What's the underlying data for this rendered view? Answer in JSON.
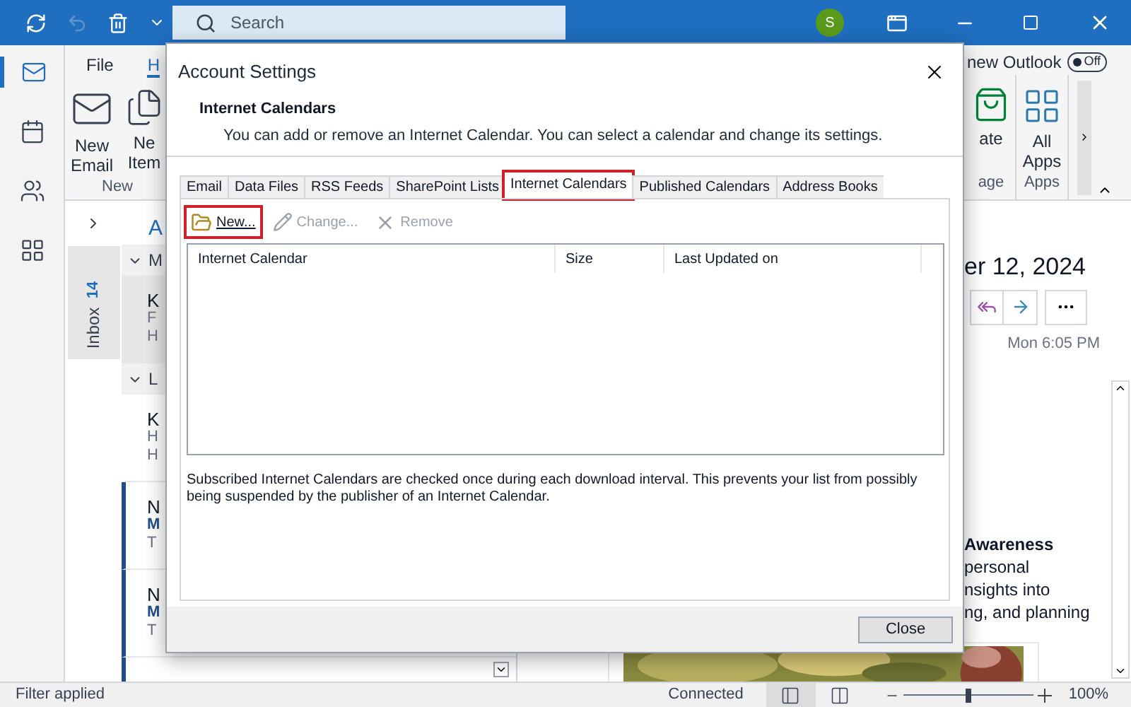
{
  "title_bar": {
    "search": {
      "placeholder": "Search"
    },
    "avatar": "S"
  },
  "nav_rail": [
    {
      "kind": "mail",
      "selected": true
    },
    {
      "kind": "calendar",
      "selected": false
    },
    {
      "kind": "people",
      "selected": false
    },
    {
      "kind": "apps",
      "selected": false
    }
  ],
  "ribbon": {
    "tabs": [
      {
        "label": "File",
        "selected": false
      },
      {
        "label": "H",
        "selected": true
      }
    ],
    "new_outlook": {
      "label": "new Outlook",
      "toggle": "Off",
      "on": false
    },
    "left_groups": [
      {
        "label": "New",
        "buttons": [
          {
            "kind": "email",
            "lines": [
              "New",
              "Email"
            ]
          },
          {
            "kind": "items",
            "lines": [
              "Ne",
              "Item"
            ]
          }
        ]
      }
    ],
    "right_groups": [
      {
        "label": "age",
        "buttons": [
          {
            "kind": "store",
            "lines": [
              "ate"
            ]
          }
        ]
      },
      {
        "label": "Apps",
        "buttons": [
          {
            "kind": "apps",
            "lines": [
              "All",
              "Apps"
            ]
          }
        ]
      }
    ]
  },
  "folder_pane": {
    "folder": "Inbox",
    "count": "14"
  },
  "message_list": {
    "heading": "A",
    "items": [
      {
        "kind": "group",
        "label": "M"
      },
      {
        "kind": "message",
        "selected": true,
        "unread": false,
        "lines": [
          "K",
          "F",
          "H"
        ]
      },
      {
        "kind": "group",
        "label": "L"
      },
      {
        "kind": "message",
        "selected": false,
        "unread": false,
        "lines": [
          "K",
          "H",
          "H"
        ]
      },
      {
        "kind": "message",
        "selected": false,
        "unread": true,
        "lines": [
          "N",
          "M",
          "T"
        ]
      },
      {
        "kind": "message",
        "selected": false,
        "unread": true,
        "lines": [
          "N",
          "M",
          "T"
        ]
      }
    ]
  },
  "reading_pane": {
    "date": "er 12, 2024",
    "time": "Mon 6:05 PM",
    "body_heading": "Awareness",
    "body_lines": [
      "personal",
      "nsights into",
      "ng, and planning"
    ]
  },
  "dialog": {
    "title": "Account Settings",
    "heading": "Internet Calendars",
    "description": "You can add or remove an Internet Calendar. You can select a calendar and change its settings.",
    "tabs": [
      {
        "label": "Email",
        "selected": false,
        "highlighted": false
      },
      {
        "label": "Data Files",
        "selected": false,
        "highlighted": false
      },
      {
        "label": "RSS Feeds",
        "selected": false,
        "highlighted": false
      },
      {
        "label": "SharePoint Lists",
        "selected": false,
        "highlighted": false
      },
      {
        "label": "Internet Calendars",
        "selected": true,
        "highlighted": true
      },
      {
        "label": "Published Calendars",
        "selected": false,
        "highlighted": false
      },
      {
        "label": "Address Books",
        "selected": false,
        "highlighted": false
      }
    ],
    "toolbar": [
      {
        "kind": "new",
        "label": "New...",
        "disabled": false,
        "highlighted": true
      },
      {
        "kind": "change",
        "label": "Change...",
        "disabled": true,
        "highlighted": false
      },
      {
        "kind": "remove",
        "label": "Remove",
        "disabled": true,
        "highlighted": false
      }
    ],
    "table": {
      "columns": [
        "Internet Calendar",
        "Size",
        "Last Updated on"
      ]
    },
    "note": "Subscribed Internet Calendars are checked once during each download interval. This prevents your list from possibly being suspended by the publisher of an Internet Calendar.",
    "buttons": [
      "Close"
    ]
  },
  "status_bar": {
    "left": "Filter applied",
    "connection": "Connected",
    "views": [
      {
        "kind": "normal",
        "selected": true
      },
      {
        "kind": "reading",
        "selected": false
      }
    ],
    "zoom": {
      "level": 0.5,
      "reading": "100%"
    }
  }
}
